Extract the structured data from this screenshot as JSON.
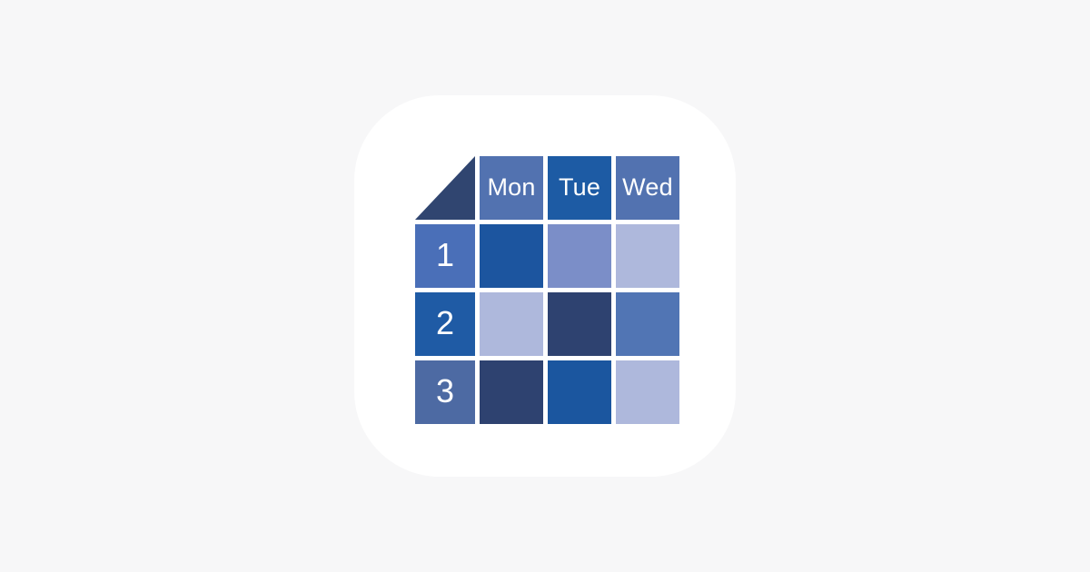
{
  "page": {
    "background_color": "#f7f7f8",
    "card_color": "#ffffff",
    "type": "app-icon"
  },
  "grid": {
    "corner": {
      "name": "corner-triangle-cell",
      "color": "#304570"
    },
    "column_headers": [
      {
        "label": "Mon",
        "color": "#5272b0",
        "text_color": "#ffffff"
      },
      {
        "label": "Tue",
        "color": "#1d5ba4",
        "text_color": "#ffffff"
      },
      {
        "label": "Wed",
        "color": "#5272b0",
        "text_color": "#ffffff"
      }
    ],
    "row_headers": [
      {
        "label": "1",
        "color": "#4a6fb8",
        "text_color": "#ffffff"
      },
      {
        "label": "2",
        "color": "#1f5ba5",
        "text_color": "#ffffff"
      },
      {
        "label": "3",
        "color": "#4d6aa3",
        "text_color": "#ffffff"
      }
    ],
    "cells": [
      [
        {
          "color": "#1c559f"
        },
        {
          "color": "#7b8ec8"
        },
        {
          "color": "#aeb8dc"
        }
      ],
      [
        {
          "color": "#aeb8dc"
        },
        {
          "color": "#2e4270"
        },
        {
          "color": "#5175b4"
        }
      ],
      [
        {
          "color": "#2e4270"
        },
        {
          "color": "#1b569f"
        },
        {
          "color": "#aeb8dc"
        }
      ]
    ]
  }
}
